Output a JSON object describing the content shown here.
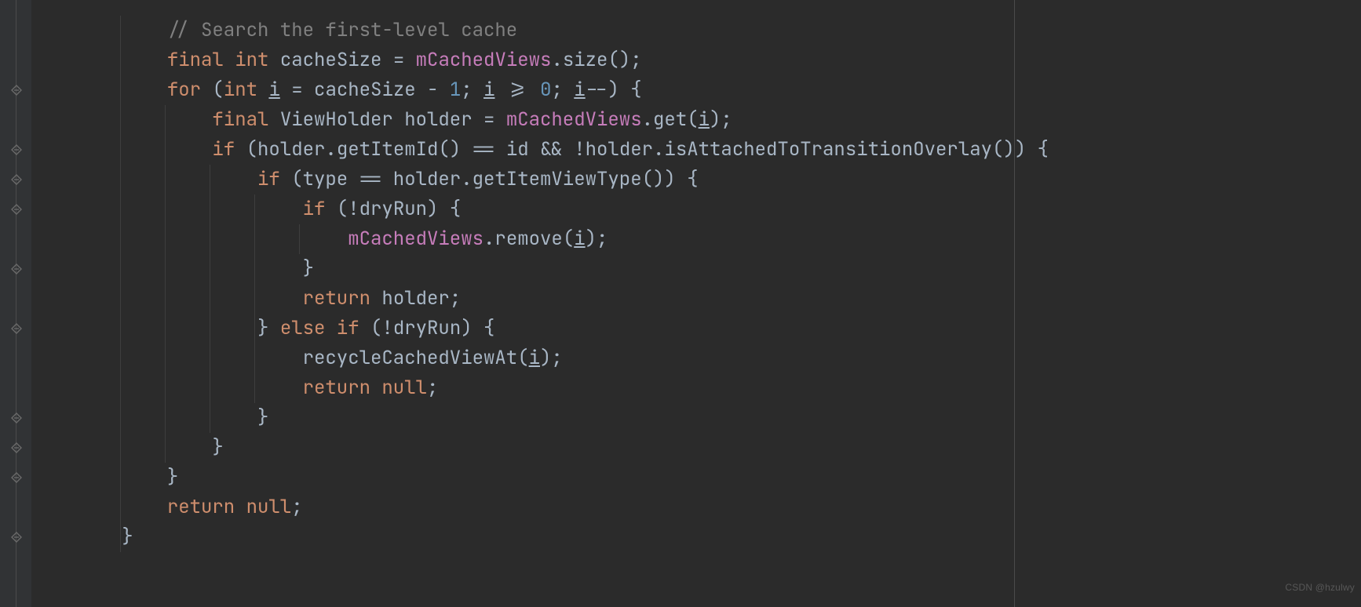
{
  "watermark": "CSDN @hzulwy",
  "fold_marks": [
    3,
    5,
    6,
    7,
    9,
    11,
    14,
    15,
    16,
    18
  ],
  "indent_unit": "    ",
  "code": {
    "lines": [
      {
        "indent": 3,
        "tokens": [
          {
            "cls": "tok-comment",
            "text": "// Search the first-level cache"
          }
        ]
      },
      {
        "indent": 3,
        "tokens": [
          {
            "cls": "tok-keyword",
            "text": "final"
          },
          {
            "cls": "tok-punct",
            "text": " "
          },
          {
            "cls": "tok-keyword",
            "text": "int"
          },
          {
            "cls": "tok-punct",
            "text": " "
          },
          {
            "cls": "tok-ident",
            "text": "cacheSize = "
          },
          {
            "cls": "tok-field",
            "text": "mCachedViews"
          },
          {
            "cls": "tok-punct",
            "text": ".size();"
          }
        ]
      },
      {
        "indent": 3,
        "tokens": [
          {
            "cls": "tok-keyword",
            "text": "for"
          },
          {
            "cls": "tok-punct",
            "text": " ("
          },
          {
            "cls": "tok-keyword",
            "text": "int"
          },
          {
            "cls": "tok-punct",
            "text": " "
          },
          {
            "cls": "tok-uvar",
            "text": "i"
          },
          {
            "cls": "tok-punct",
            "text": " = cacheSize - "
          },
          {
            "cls": "tok-num",
            "text": "1"
          },
          {
            "cls": "tok-punct",
            "text": "; "
          },
          {
            "cls": "tok-uvar",
            "text": "i"
          },
          {
            "cls": "tok-punct",
            "text": " >= "
          },
          {
            "cls": "tok-num",
            "text": "0"
          },
          {
            "cls": "tok-punct",
            "text": "; "
          },
          {
            "cls": "tok-uvar",
            "text": "i"
          },
          {
            "cls": "tok-punct",
            "text": "--) {"
          }
        ]
      },
      {
        "indent": 4,
        "tokens": [
          {
            "cls": "tok-keyword",
            "text": "final"
          },
          {
            "cls": "tok-punct",
            "text": " "
          },
          {
            "cls": "tok-type",
            "text": "ViewHolder holder = "
          },
          {
            "cls": "tok-field",
            "text": "mCachedViews"
          },
          {
            "cls": "tok-punct",
            "text": ".get("
          },
          {
            "cls": "tok-uvar",
            "text": "i"
          },
          {
            "cls": "tok-punct",
            "text": ");"
          }
        ]
      },
      {
        "indent": 4,
        "tokens": [
          {
            "cls": "tok-keyword",
            "text": "if"
          },
          {
            "cls": "tok-punct",
            "text": " (holder.getItemId() == id && !holder.isAttachedToTransitionOverlay()) {"
          }
        ]
      },
      {
        "indent": 5,
        "tokens": [
          {
            "cls": "tok-keyword",
            "text": "if"
          },
          {
            "cls": "tok-punct",
            "text": " (type == holder.getItemViewType()) {"
          }
        ]
      },
      {
        "indent": 6,
        "tokens": [
          {
            "cls": "tok-keyword",
            "text": "if"
          },
          {
            "cls": "tok-punct",
            "text": " (!dryRun) {"
          }
        ]
      },
      {
        "indent": 7,
        "tokens": [
          {
            "cls": "tok-field",
            "text": "mCachedViews"
          },
          {
            "cls": "tok-punct",
            "text": ".remove("
          },
          {
            "cls": "tok-uvar",
            "text": "i"
          },
          {
            "cls": "tok-punct",
            "text": ");"
          }
        ]
      },
      {
        "indent": 6,
        "tokens": [
          {
            "cls": "tok-punct",
            "text": "}"
          }
        ]
      },
      {
        "indent": 6,
        "tokens": [
          {
            "cls": "tok-keyword",
            "text": "return"
          },
          {
            "cls": "tok-punct",
            "text": " holder;"
          }
        ]
      },
      {
        "indent": 5,
        "tokens": [
          {
            "cls": "tok-punct",
            "text": "} "
          },
          {
            "cls": "tok-keyword",
            "text": "else if"
          },
          {
            "cls": "tok-punct",
            "text": " (!dryRun) {"
          }
        ]
      },
      {
        "indent": 6,
        "tokens": [
          {
            "cls": "tok-punct",
            "text": "recycleCachedViewAt("
          },
          {
            "cls": "tok-uvar",
            "text": "i"
          },
          {
            "cls": "tok-punct",
            "text": ");"
          }
        ]
      },
      {
        "indent": 6,
        "tokens": [
          {
            "cls": "tok-keyword",
            "text": "return null"
          },
          {
            "cls": "tok-punct",
            "text": ";"
          }
        ]
      },
      {
        "indent": 5,
        "tokens": [
          {
            "cls": "tok-punct",
            "text": "}"
          }
        ]
      },
      {
        "indent": 4,
        "tokens": [
          {
            "cls": "tok-punct",
            "text": "}"
          }
        ]
      },
      {
        "indent": 3,
        "tokens": [
          {
            "cls": "tok-punct",
            "text": "}"
          }
        ]
      },
      {
        "indent": 3,
        "tokens": [
          {
            "cls": "tok-keyword",
            "text": "return null"
          },
          {
            "cls": "tok-punct",
            "text": ";"
          }
        ]
      },
      {
        "indent": 2,
        "tokens": [
          {
            "cls": "tok-punct",
            "text": "}"
          }
        ]
      }
    ]
  }
}
